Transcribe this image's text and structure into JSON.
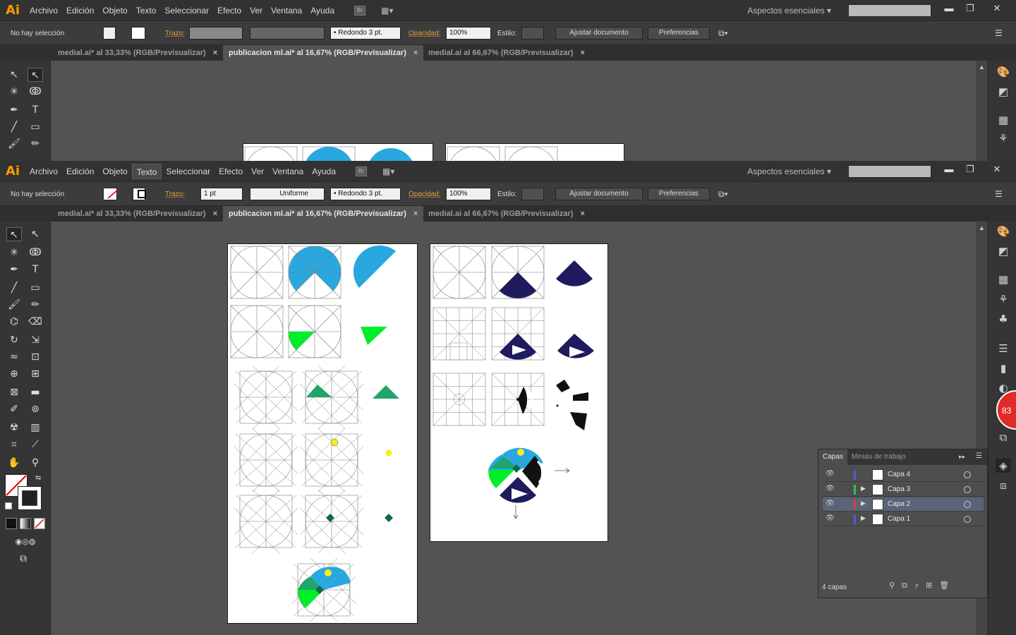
{
  "app": {
    "logo": "Ai"
  },
  "menu": [
    "Archivo",
    "Edición",
    "Objeto",
    "Texto",
    "Seleccionar",
    "Efecto",
    "Ver",
    "Ventana",
    "Ayuda"
  ],
  "br_label": "Br",
  "workspace": "Aspectos esenciales",
  "window_controls": {
    "minimize": "▬",
    "restore": "❐",
    "close": "✕"
  },
  "control": {
    "selection": "No hay selección",
    "stroke_label": "Trazo:",
    "stroke_value": "1 pt",
    "profile": "Uniforme",
    "brush": "Redondo 3 pt.",
    "opacity_label": "Opacidad:",
    "opacity_value": "100%",
    "style_label": "Estilo:",
    "adjust_btn": "Ajustar documento",
    "prefs_btn": "Preferencias"
  },
  "tabs": [
    {
      "label": "medial.ai* al 33,33% (RGB/Previsualizar)",
      "close": "×"
    },
    {
      "label": "publicacion ml.ai* al 16,67% (RGB/Previsualizar)",
      "close": "×"
    },
    {
      "label": "medial.ai al 66,67% (RGB/Previsualizar)",
      "close": "×"
    }
  ],
  "tools": {
    "type_glyph": "T"
  },
  "notification_count": "83",
  "layers_panel": {
    "tabs": [
      "Capas",
      "Mesas de trabajo"
    ],
    "layers": [
      {
        "name": "Capa 4",
        "color": "#4f5bd5"
      },
      {
        "name": "Capa 3",
        "color": "#3fbf3f"
      },
      {
        "name": "Capa 2",
        "color": "#d94040"
      },
      {
        "name": "Capa 1",
        "color": "#4f5bd5"
      }
    ],
    "count": "4 capas"
  },
  "colors": {
    "accent_orange": "#ff9a00",
    "blue": "#29a7df",
    "navy": "#1e1b5e",
    "green": "#00ee2a",
    "teal": "#1fa56b",
    "yellow": "#f7ef1a",
    "dkgreen": "#0d6b43"
  }
}
